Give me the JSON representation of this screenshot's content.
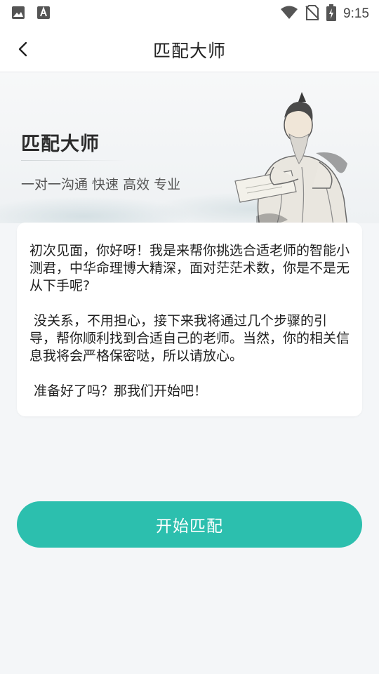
{
  "status_bar": {
    "time": "9:15",
    "icons": [
      "image-icon",
      "font-icon",
      "wifi-icon",
      "no-sim-icon",
      "battery-charging-icon"
    ]
  },
  "header": {
    "title": "匹配大师",
    "back_icon": "chevron-left-icon"
  },
  "hero": {
    "title": "匹配大师",
    "subtitle": "一对一沟通  快速 高效 专业",
    "illustration": "sage-reading-scroll-illustration"
  },
  "intro": {
    "paragraphs": [
      "初次见面，你好呀！我是来帮你挑选合适老师的智能小测君，中华命理博大精深，面对茫茫术数，你是不是无从下手呢?",
      " 没关系，不用担心，接下来我将通过几个步骤的引导，帮你顺利找到合适自己的老师。当然，你的相关信息我将会严格保密哒，所以请放心。",
      " 准备好了吗？那我们开始吧！"
    ]
  },
  "actions": {
    "start_label": "开始匹配"
  },
  "colors": {
    "accent": "#2cbfae",
    "background": "#f4f6f8",
    "card": "#ffffff"
  }
}
